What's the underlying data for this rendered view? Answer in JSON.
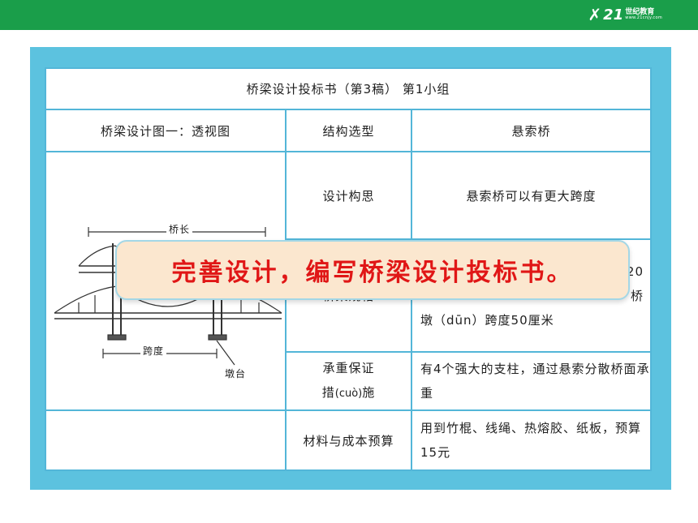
{
  "header": {
    "logo_num": "21",
    "logo_text": "世纪教育",
    "logo_url": "www.21cnjy.com"
  },
  "table": {
    "title": "桥梁设计投标书（第3稿）   第1小组",
    "diagram_label": "桥梁设计图一：透视图",
    "rows": [
      {
        "label": "结构选型",
        "value": "悬索桥"
      },
      {
        "label": "设计构思",
        "value": "悬索桥可以有更大跨度"
      },
      {
        "label": "桥梁规格",
        "value_line1": "20",
        "value_line2": "桥",
        "value_line3": "墩（dūn）跨度50厘米"
      },
      {
        "label_line1": "承重保证",
        "label_line2a": "措",
        "label_pinyin": "(cuò)",
        "label_line2b": "施",
        "value": "有4个强大的支柱，通过悬索分散桥面承重"
      },
      {
        "label": "材料与成本预算",
        "value": "用到竹棍、线绳、热熔胶、纸板，预算15元"
      }
    ],
    "diagram": {
      "span_length_label": "桥长",
      "span_label": "跨度",
      "pier_label": "墩台"
    }
  },
  "banner": {
    "text": "完善设计，编写桥梁设计投标书。"
  },
  "colors": {
    "top_bar": "#1a9e4a",
    "card_border": "#5cc2df",
    "banner_bg": "#fbe7cf",
    "banner_text": "#e01616"
  }
}
